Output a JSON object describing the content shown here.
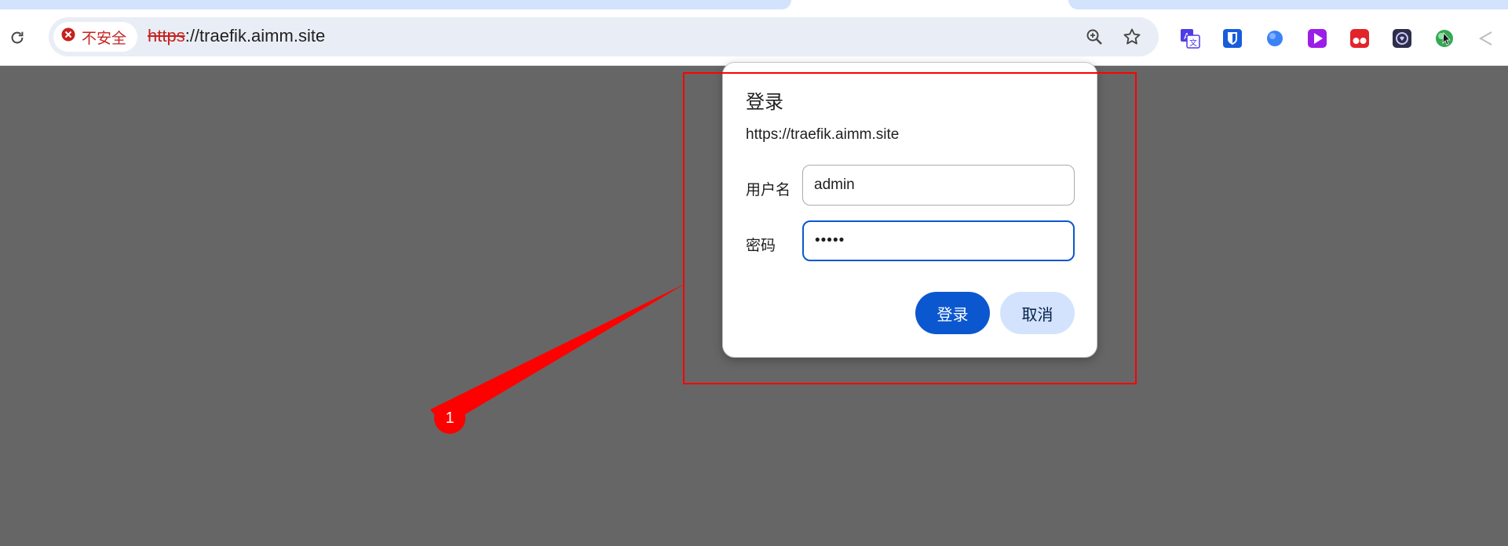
{
  "browser": {
    "security_label": "不安全",
    "url_scheme": "https",
    "url_rest": "://traefik.aimm.site",
    "icons": {
      "reload": "reload-icon",
      "security": "not-secure-icon",
      "zoom": "zoom-icon",
      "bookmark": "bookmark-star-icon"
    },
    "extensions": [
      "translate-icon",
      "bitwarden-icon",
      "blue-dot-icon",
      "play-icon",
      "red-ext-icon",
      "dark-ext-icon",
      "green-ext-icon",
      "back-arrow-icon"
    ]
  },
  "dialog": {
    "title": "登录",
    "origin": "https://traefik.aimm.site",
    "username_label": "用户名",
    "username_value": "admin",
    "password_label": "密码",
    "password_value": "•••••",
    "login_button": "登录",
    "cancel_button": "取消"
  },
  "annotation": {
    "badge_text": "1",
    "color": "#ff0000"
  },
  "colors": {
    "backdrop": "#666666",
    "primary": "#0b57d0",
    "secondary": "#d3e3fd",
    "insecure": "#c5221f"
  }
}
